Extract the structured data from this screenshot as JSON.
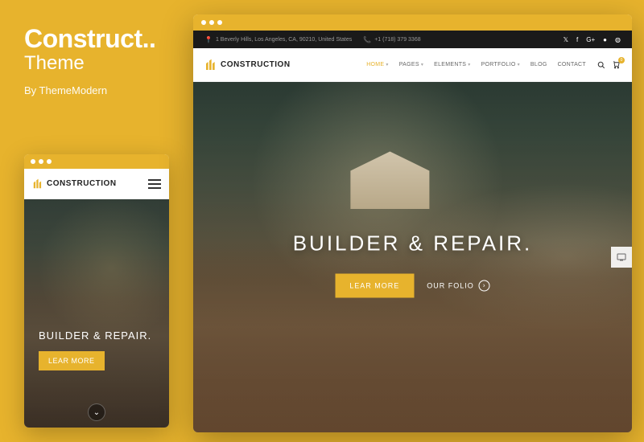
{
  "promo": {
    "title": "Construct..",
    "subtitle": "Theme",
    "author": "By ThemeModern"
  },
  "brand": {
    "name": "CONSTRUCTION"
  },
  "topbar": {
    "address": "1 Beverly Hills, Los Angeles, CA, 90210, United States",
    "phone": "+1 (718) 379 3368"
  },
  "nav": {
    "items": [
      {
        "label": "HOME",
        "active": true,
        "dropdown": true
      },
      {
        "label": "PAGES",
        "active": false,
        "dropdown": true
      },
      {
        "label": "ELEMENTS",
        "active": false,
        "dropdown": true
      },
      {
        "label": "PORTFOLIO",
        "active": false,
        "dropdown": true
      },
      {
        "label": "BLOG",
        "active": false,
        "dropdown": false
      },
      {
        "label": "CONTACT",
        "active": false,
        "dropdown": false
      }
    ],
    "cart_count": "0"
  },
  "hero": {
    "title": "BUILDER & REPAIR.",
    "cta_primary": "LEAR MORE",
    "cta_secondary": "OUR FOLIO"
  },
  "mobile_hero": {
    "title": "BUILDER & REPAIR.",
    "cta": "LEAR MORE"
  }
}
